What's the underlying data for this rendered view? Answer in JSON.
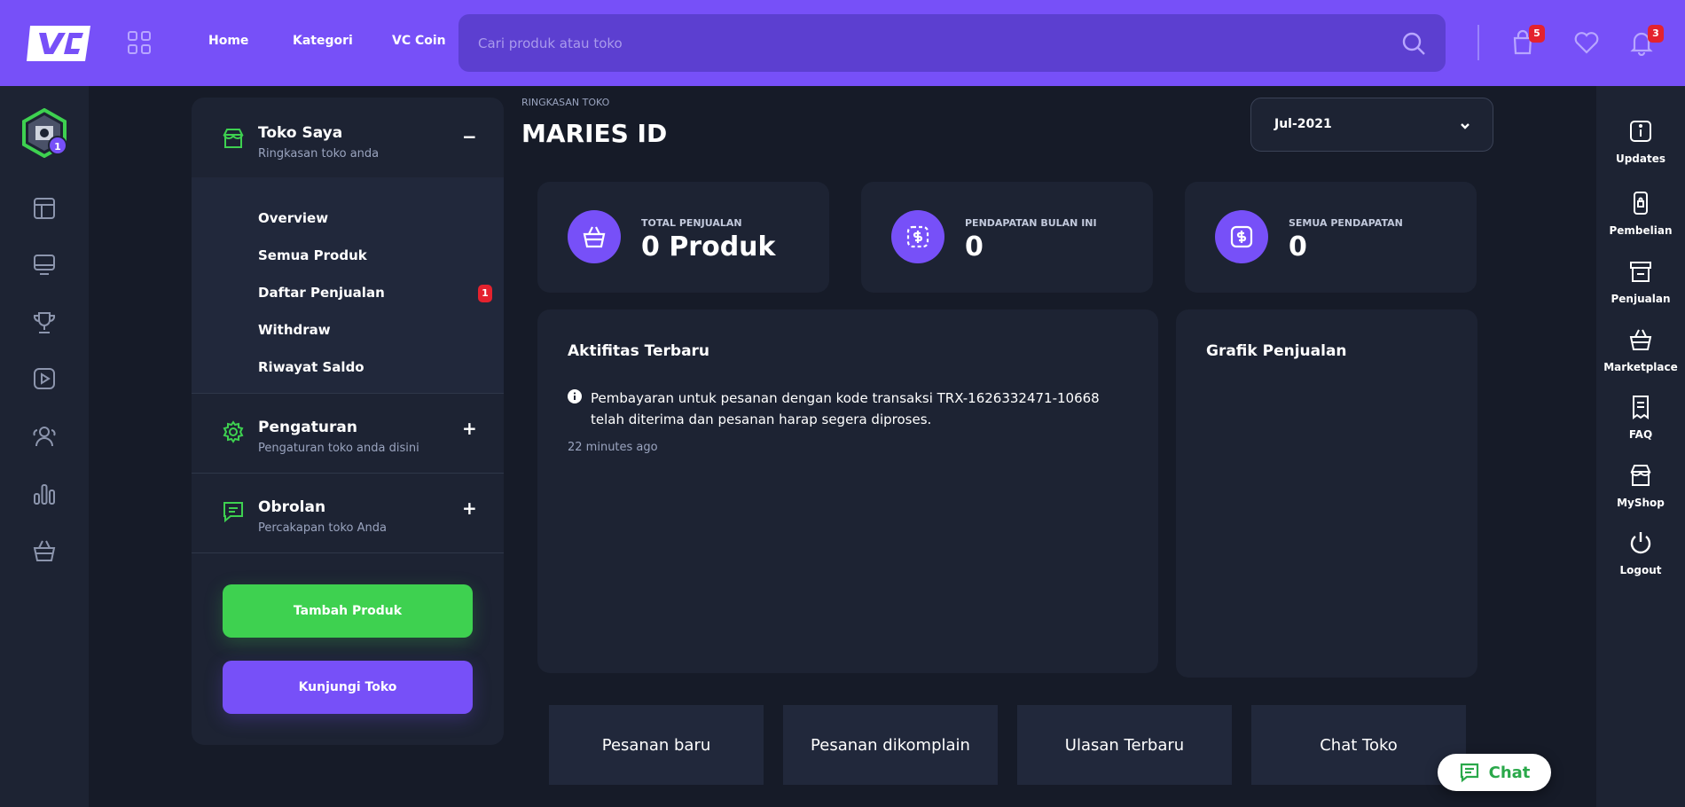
{
  "topbar": {
    "logo_text": "VC",
    "nav": [
      "Home",
      "Kategori",
      "VC Coin"
    ],
    "search_placeholder": "Cari produk atau toko",
    "cart_count": "5",
    "notif_count": "3"
  },
  "leftrail": {
    "avatar_level": "1",
    "icons": [
      "layout-icon",
      "monitor-icon",
      "trophy-icon",
      "play-icon",
      "users-icon",
      "chart-bars-icon",
      "basket-icon"
    ]
  },
  "rightrail": {
    "items": [
      {
        "label": "Updates",
        "icon": "info-square-icon"
      },
      {
        "label": "Pembelian",
        "icon": "phone-bag-icon"
      },
      {
        "label": "Penjualan",
        "icon": "store-icon"
      },
      {
        "label": "Marketplace",
        "icon": "basket-icon"
      },
      {
        "label": "FAQ",
        "icon": "receipt-icon"
      },
      {
        "label": "MyShop",
        "icon": "shop-icon"
      },
      {
        "label": "Logout",
        "icon": "power-icon"
      }
    ]
  },
  "sidemenu": {
    "toko": {
      "title": "Toko Saya",
      "subtitle": "Ringkasan toko anda",
      "toggle": "−"
    },
    "submenu": [
      {
        "label": "Overview"
      },
      {
        "label": "Semua Produk"
      },
      {
        "label": "Daftar Penjualan",
        "badge": "1"
      },
      {
        "label": "Withdraw"
      },
      {
        "label": "Riwayat Saldo"
      }
    ],
    "pengaturan": {
      "title": "Pengaturan",
      "subtitle": "Pengaturan toko anda disini",
      "toggle": "+"
    },
    "obrolan": {
      "title": "Obrolan",
      "subtitle": "Percakapan toko Anda",
      "toggle": "+"
    },
    "add_product_label": "Tambah Produk",
    "visit_store_label": "Kunjungi Toko"
  },
  "main": {
    "small_label": "RINGKASAN TOKO",
    "title": "MARIES ID",
    "month": "Jul-2021",
    "stats": [
      {
        "label": "TOTAL PENJUALAN",
        "value": "0 Produk"
      },
      {
        "label": "PENDAPATAN BULAN INI",
        "value": "0"
      },
      {
        "label": "SEMUA PENDAPATAN",
        "value": "0"
      }
    ],
    "activity": {
      "title": "Aktifitas Terbaru",
      "text": "Pembayaran untuk pesanan dengan kode transaksi TRX-1626332471-10668 telah diterima dan pesanan harap segera diproses.",
      "time": "22 minutes ago"
    },
    "chart_panel_title": "Grafik Penjualan",
    "tabs": [
      "Pesanan baru",
      "Pesanan dikomplain",
      "Ulasan Terbaru",
      "Chat Toko"
    ]
  },
  "chat": {
    "label": "Chat"
  },
  "colors": {
    "primary": "#7750f8",
    "green": "#3ed150",
    "badge": "#e4222e",
    "background": "#161b28",
    "panel": "#1d2333"
  }
}
